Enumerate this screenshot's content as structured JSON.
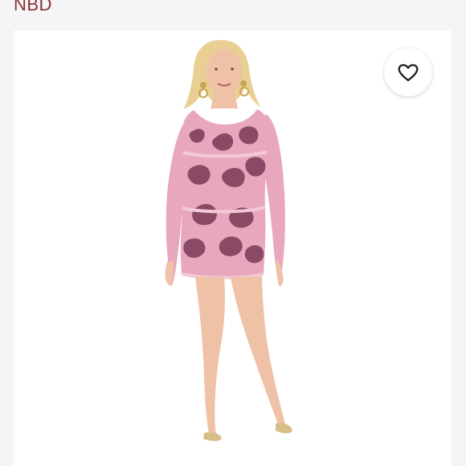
{
  "header": {
    "brand": "NBD"
  },
  "product": {
    "image_description_icon": "dress-photo",
    "like_icon": "heart-outline-icon"
  },
  "colors": {
    "brand": "#8b2f3a",
    "dress_pink": "#e8a7bd",
    "dress_print": "#8a4a66",
    "skin": "#efc2a8",
    "hair": "#e9cf94"
  }
}
